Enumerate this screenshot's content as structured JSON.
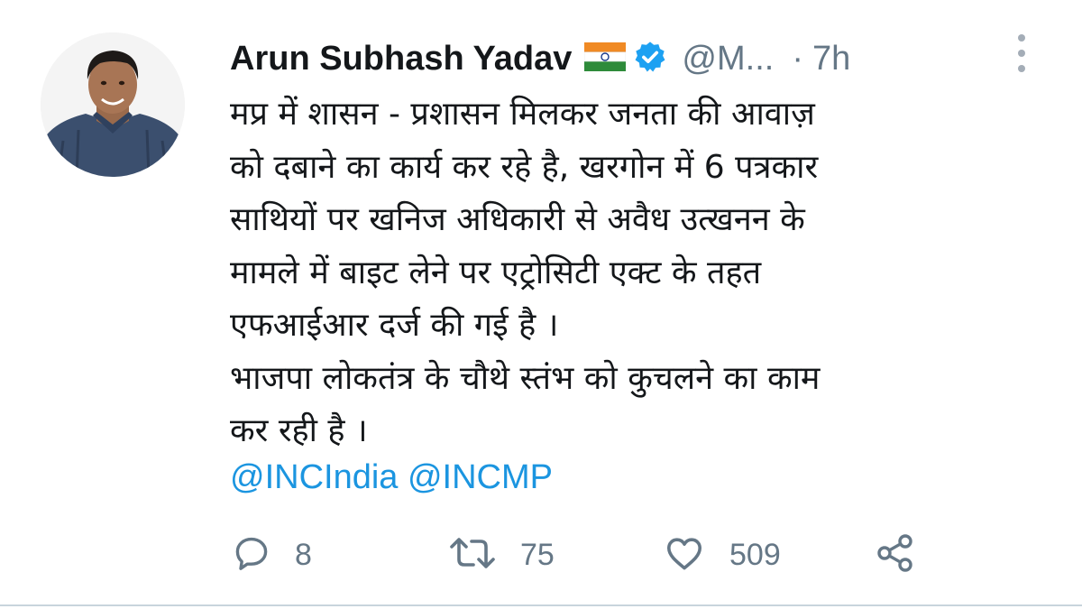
{
  "author": {
    "name": "Arun Subhash Yadav",
    "handle": "@M...",
    "separator": "·",
    "time": "7h"
  },
  "icons": {
    "avatar": "profile-photo",
    "flag": "india-flag-icon",
    "verified": "verified-badge-icon",
    "more": "more-options-icon",
    "reply": "reply-icon",
    "retweet": "retweet-icon",
    "like": "like-icon",
    "share": "share-icon"
  },
  "tweet": {
    "lines": [
      "मप्र में शासन - प्रशासन मिलकर जनता की आवाज़",
      "को दबाने का कार्य कर रहे है, खरगोन में 6 पत्रकार",
      "साथियों पर खनिज अधिकारी से अवैध उत्खनन के",
      "मामले में बाइट लेने पर एट्रोसिटी एक्ट के तहत",
      "एफआईआर दर्ज की गई है ।",
      "भाजपा लोकतंत्र के चौथे स्तंभ को कुचलने का काम",
      "कर रही है ।"
    ],
    "mentions": [
      "@INCIndia",
      "@INCMP"
    ]
  },
  "actions": {
    "replies": "8",
    "retweets": "75",
    "likes": "509"
  },
  "colors": {
    "text": "#14171a",
    "secondary": "#657786",
    "link": "#1b95e0",
    "verified": "#1da1f2",
    "icon": "#657786"
  }
}
